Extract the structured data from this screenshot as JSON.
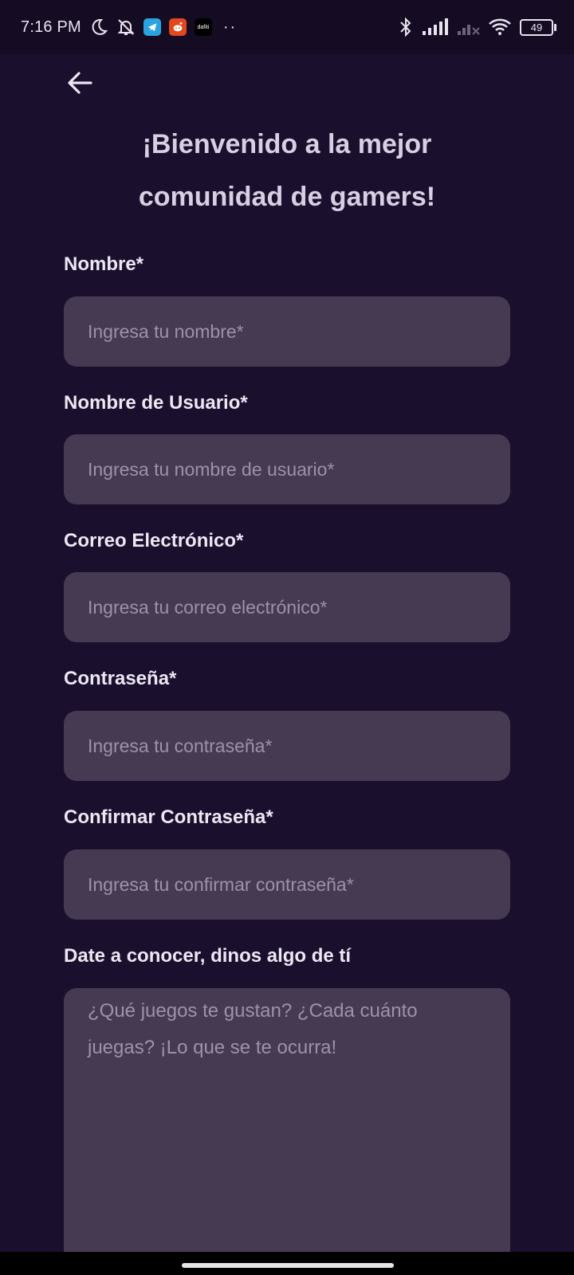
{
  "status_bar": {
    "time": "7:16 PM",
    "dafiti_label": "dafiti",
    "battery": "49",
    "more": "··"
  },
  "header": {
    "title": "¡Bienvenido a la mejor comunidad de gamers!"
  },
  "form": {
    "name_label": "Nombre*",
    "name_placeholder": "Ingresa tu nombre*",
    "username_label": "Nombre de Usuario*",
    "username_placeholder": "Ingresa tu nombre de usuario*",
    "email_label": "Correo Electrónico*",
    "email_placeholder": "Ingresa tu correo electrónico*",
    "password_label": "Contraseña*",
    "password_placeholder": "Ingresa tu contraseña*",
    "confirm_label": "Confirmar Contraseña*",
    "confirm_placeholder": "Ingresa tu confirmar contraseña*",
    "bio_label": "Date a conocer, dinos algo de tí",
    "bio_placeholder": "¿Qué juegos te gustan? ¿Cada cuánto juegas? ¡Lo que se te ocurra!"
  },
  "colors": {
    "background": "#1b0f2e",
    "input_background": "#463a52",
    "title": "#d7cfe2",
    "label": "#ece8f2",
    "placeholder": "#9c92a8"
  }
}
